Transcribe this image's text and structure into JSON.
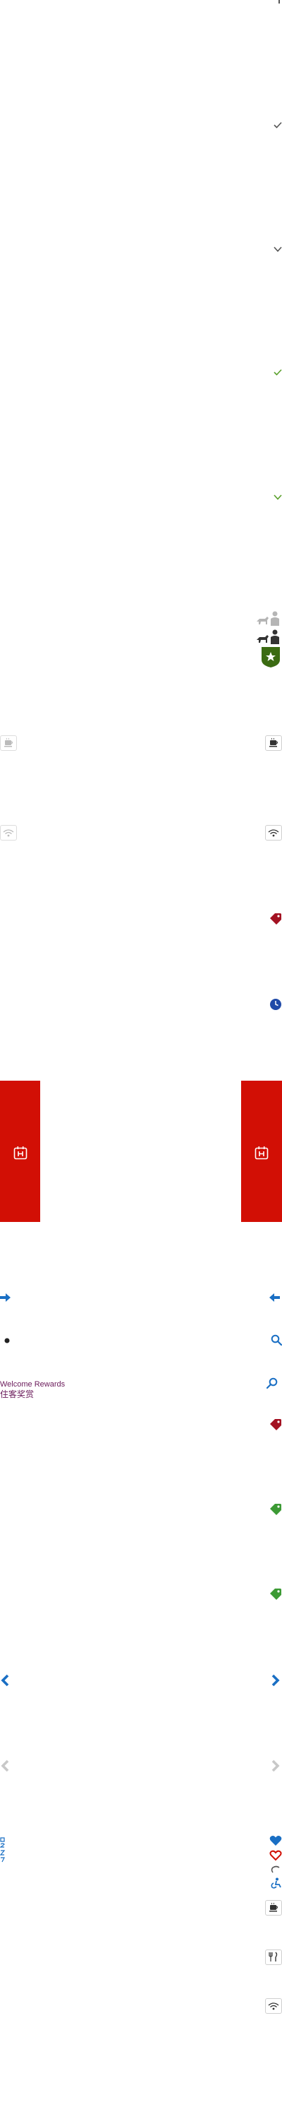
{
  "branding": {
    "program_name_en": "Welcome Rewards",
    "program_name_zh": "住客奖赏"
  },
  "colors": {
    "dark_check": "#555555",
    "green_check": "#5aa02c",
    "red_accent": "#d20f05",
    "tag_red": "#a31222",
    "tag_green": "#3c9a34",
    "brand_purple": "#6a1a5a",
    "blue": "#1a6fc4",
    "grey_arrow": "#c8c8c8",
    "dark_green_badge": "#3b6b12"
  },
  "icons": [
    "check-icon",
    "chevron-down-icon",
    "pets-family-icon",
    "star-badge-icon",
    "coffee-maker-icon",
    "wifi-icon",
    "tag-icon",
    "clock-icon",
    "hotel-icon",
    "arrow-right-icon",
    "arrow-left-icon",
    "search-icon",
    "chevron-left-icon",
    "chevron-right-icon",
    "heart-icon",
    "heart-outline-icon",
    "accessible-icon",
    "restaurant-icon"
  ]
}
